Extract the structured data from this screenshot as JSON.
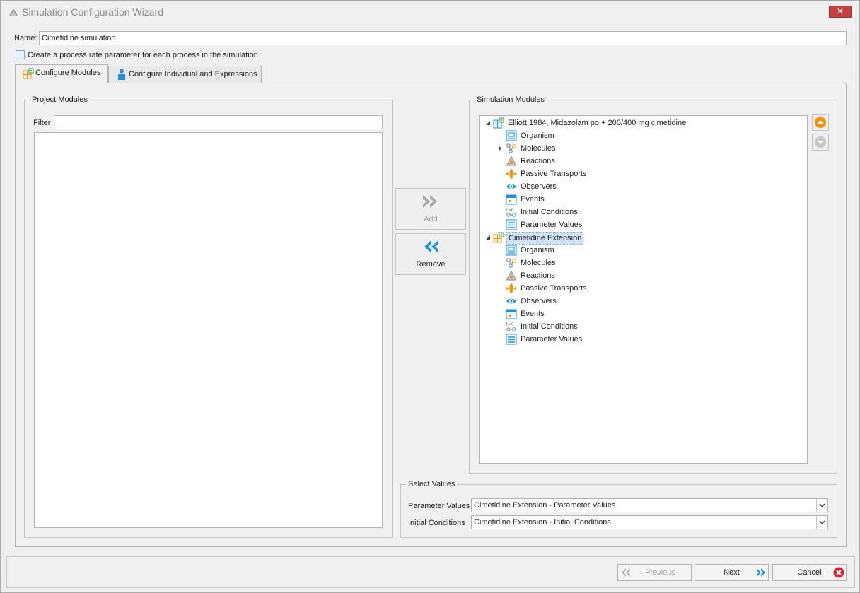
{
  "window": {
    "title": "Simulation Configuration Wizard",
    "close_symbol": "✕"
  },
  "form": {
    "name_label": "Name:",
    "name_value": "Cimetidine simulation",
    "checkbox_label": "Create a process rate parameter for each process in the simulation",
    "checkbox_checked": false
  },
  "tabs": [
    {
      "label": "Configure Modules",
      "icon": "module-icon",
      "active": true
    },
    {
      "label": "Configure Individual and Expressions",
      "icon": "person-icon",
      "active": false
    }
  ],
  "project_modules": {
    "title": "Project Modules",
    "filter_label": "Filter",
    "filter_value": ""
  },
  "actions": {
    "add_label": "Add",
    "remove_label": "Remove"
  },
  "simulation_modules": {
    "title": "Simulation Modules",
    "tree": [
      {
        "label": "Elliott 1984, Midazolam po + 200/400 mg cimetidine",
        "expanded": true,
        "selected": false,
        "children": [
          {
            "label": "Organism",
            "icon": "organism-icon",
            "has_children": false
          },
          {
            "label": "Molecules",
            "icon": "molecules-icon",
            "has_children": true
          },
          {
            "label": "Reactions",
            "icon": "reactions-icon",
            "has_children": false
          },
          {
            "label": "Passive Transports",
            "icon": "passive-transports-icon",
            "has_children": false
          },
          {
            "label": "Observers",
            "icon": "observers-icon",
            "has_children": false
          },
          {
            "label": "Events",
            "icon": "events-icon",
            "has_children": false
          },
          {
            "label": "Initial Conditions",
            "icon": "initial-conditions-icon",
            "has_children": false
          },
          {
            "label": "Parameter Values",
            "icon": "parameter-values-icon",
            "has_children": false
          }
        ]
      },
      {
        "label": "Cimetidine Extension",
        "expanded": true,
        "selected": true,
        "children": [
          {
            "label": "Organism",
            "icon": "organism-icon",
            "has_children": false
          },
          {
            "label": "Molecules",
            "icon": "molecules-icon",
            "has_children": false
          },
          {
            "label": "Reactions",
            "icon": "reactions-icon",
            "has_children": false
          },
          {
            "label": "Passive Transports",
            "icon": "passive-transports-icon",
            "has_children": false
          },
          {
            "label": "Observers",
            "icon": "observers-icon",
            "has_children": false
          },
          {
            "label": "Events",
            "icon": "events-icon",
            "has_children": false
          },
          {
            "label": "Initial Conditions",
            "icon": "initial-conditions-icon",
            "has_children": false
          },
          {
            "label": "Parameter Values",
            "icon": "parameter-values-icon",
            "has_children": false
          }
        ]
      }
    ]
  },
  "select_values": {
    "title": "Select Values",
    "parameter_values_label": "Parameter Values",
    "parameter_values_selected": "Cimetidine Extension - Parameter Values",
    "initial_conditions_label": "Initial Conditions",
    "initial_conditions_selected": "Cimetidine Extension - Initial Conditions"
  },
  "footer": {
    "previous_label": "Previous",
    "next_label": "Next",
    "cancel_label": "Cancel"
  },
  "colors": {
    "accent_blue": "#1e90d8",
    "orange": "#f29400",
    "cancel_red": "#d9232e",
    "selection": "#cfe3f7"
  }
}
